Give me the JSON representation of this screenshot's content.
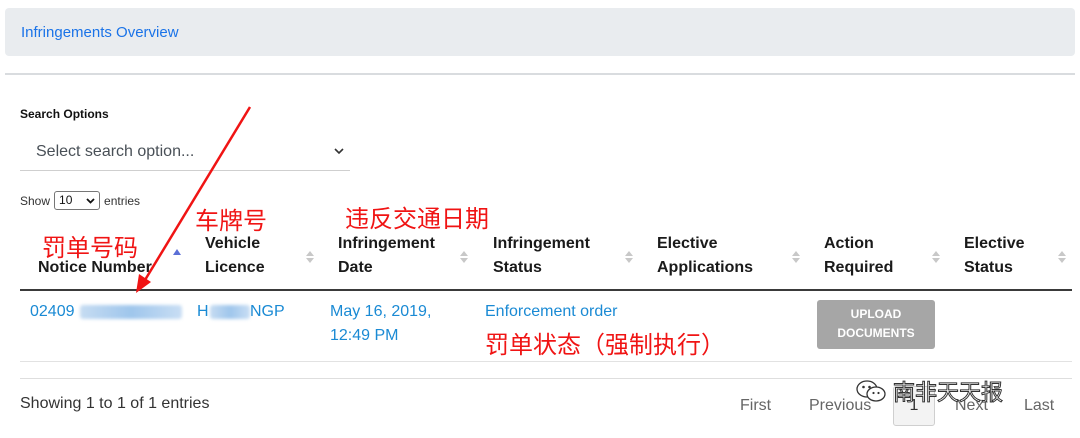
{
  "header": {
    "title": "Infringements Overview"
  },
  "search": {
    "label": "Search Options",
    "placeholder": "Select search option..."
  },
  "length": {
    "show": "Show",
    "value": "10",
    "entries": "entries"
  },
  "table": {
    "columns": [
      {
        "label_1": "Notice Number",
        "label_2": ""
      },
      {
        "label_1": "Vehicle",
        "label_2": "Licence"
      },
      {
        "label_1": "Infringement",
        "label_2": "Date"
      },
      {
        "label_1": "Infringement",
        "label_2": "Status"
      },
      {
        "label_1": "Elective",
        "label_2": "Applications"
      },
      {
        "label_1": "Action",
        "label_2": "Required"
      },
      {
        "label_1": "Elective",
        "label_2": "Status"
      }
    ],
    "rows": [
      {
        "notice_prefix": "02409",
        "licence_prefix": "H",
        "licence_suffix": "NGP",
        "date_line1": "May 16, 2019,",
        "date_line2": "12:49 PM",
        "status": "Enforcement order",
        "action_line1": "UPLOAD",
        "action_line2": "DOCUMENTS"
      }
    ]
  },
  "footer": {
    "info": "Showing 1 to 1 of 1 entries",
    "first": "First",
    "previous": "Previous",
    "current_page": "1",
    "next": "Next",
    "last": "Last"
  },
  "annotations": {
    "notice": "罚单号码",
    "plate": "车牌号",
    "date": "违反交通日期",
    "status": "罚单状态（强制执行）"
  },
  "watermark": {
    "text": "南非天天报"
  },
  "colors": {
    "link": "#1a8ad4",
    "header_link": "#1a73e8",
    "annotation": "#f01414",
    "button": "#a6a6a6"
  }
}
